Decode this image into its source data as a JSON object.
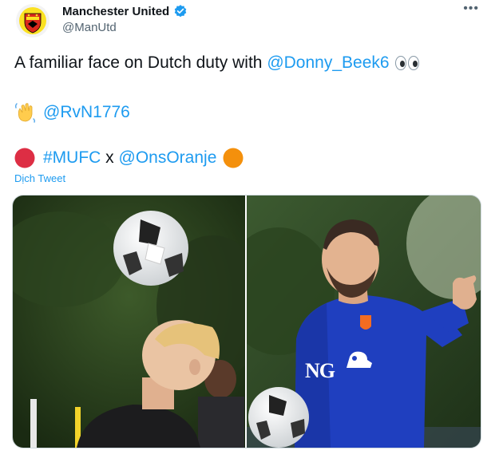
{
  "tweet": {
    "author_name": "Manchester United",
    "author_handle": "@ManUtd",
    "line1": {
      "text": "A familiar face on Dutch duty with ",
      "mention": "@Donny_Beek6"
    },
    "line2": {
      "mention": "@RvN1776"
    },
    "line3": {
      "hashtag": "#MUFC",
      "connector": " x ",
      "mention": "@OnsOranje"
    },
    "translate_label": "Dịch Tweet",
    "more_label": "•••"
  },
  "colors": {
    "link": "#1d9bf0",
    "verified": "#1d9bf0",
    "red_circle": "#dd2e44",
    "orange_circle": "#f4900c"
  },
  "icons": {
    "avatar": "manchester-united-crest",
    "verified": "verified-badge",
    "eyes": "eyes-emoji",
    "wave": "waving-hand-emoji"
  },
  "photo_text": {
    "shirt_sponsor": "NG"
  }
}
